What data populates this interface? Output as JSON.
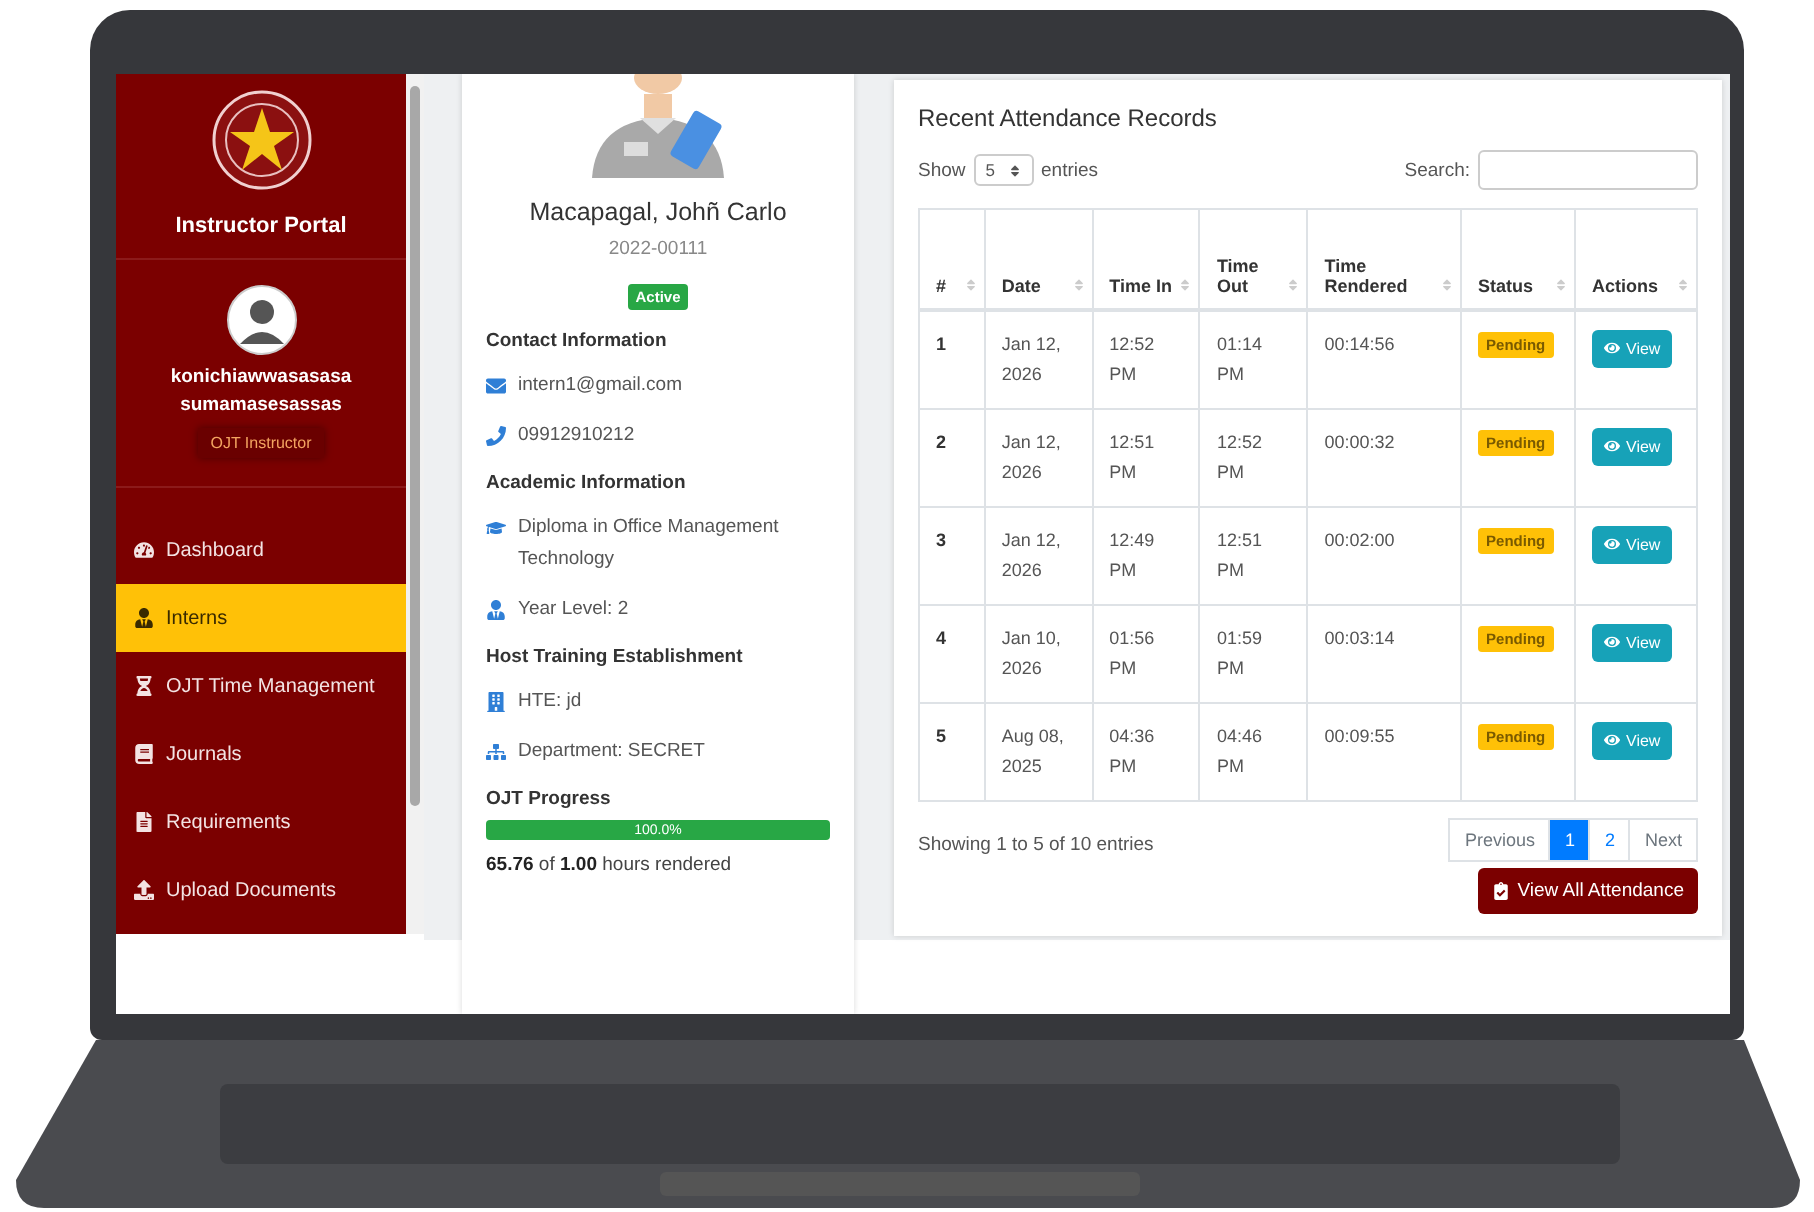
{
  "sidebar": {
    "title": "Instructor Portal",
    "user_name": "konichiawwasasasa sumamasesassas",
    "role": "OJT Instructor",
    "nav": [
      {
        "label": "Dashboard",
        "selected": false
      },
      {
        "label": "Interns",
        "selected": true
      },
      {
        "label": "OJT Time Management",
        "selected": false
      },
      {
        "label": "Journals",
        "selected": false
      },
      {
        "label": "Requirements",
        "selected": false
      },
      {
        "label": "Upload Documents",
        "selected": false
      }
    ]
  },
  "profile": {
    "name": "Macapagal, Johñ Carlo",
    "student_id": "2022-00111",
    "status": "Active",
    "sections": [
      {
        "heading": "Contact Information",
        "items": [
          "intern1@gmail.com",
          "09912910212"
        ]
      },
      {
        "heading": "Academic Information",
        "items": [
          "Diploma in Office Management Technology",
          "Year Level: 2"
        ]
      },
      {
        "heading": "Host Training Establishment",
        "items": [
          "HTE: jd",
          "Department: SECRET"
        ]
      }
    ],
    "progress": {
      "heading": "OJT Progress",
      "level": 1.0,
      "reading": "100.0%",
      "summary": "**65.76** of **1.00** hours rendered"
    }
  },
  "attendance": {
    "title": "Recent Attendance Records",
    "show_label": "Show",
    "page_size": "5",
    "entries_label": "entries",
    "search_label": "Search:",
    "columns": [
      "#",
      "Date",
      "Time In",
      "Time Out",
      "Time Rendered",
      "Status",
      "Actions"
    ],
    "rows": [
      {
        "no": "1",
        "date": "Jan 12, 2026",
        "time_in": "12:52 PM",
        "time_out": "01:14 PM",
        "rendered": "00:14:56",
        "status": "Pending",
        "action": "View"
      },
      {
        "no": "2",
        "date": "Jan 12, 2026",
        "time_in": "12:51 PM",
        "time_out": "12:52 PM",
        "rendered": "00:00:32",
        "status": "Pending",
        "action": "View"
      },
      {
        "no": "3",
        "date": "Jan 12, 2026",
        "time_in": "12:49 PM",
        "time_out": "12:51 PM",
        "rendered": "00:02:00",
        "status": "Pending",
        "action": "View"
      },
      {
        "no": "4",
        "date": "Jan 10, 2026",
        "time_in": "01:56 PM",
        "time_out": "01:59 PM",
        "rendered": "00:03:14",
        "status": "Pending",
        "action": "View"
      },
      {
        "no": "5",
        "date": "Aug 08, 2025",
        "time_in": "04:36 PM",
        "time_out": "04:46 PM",
        "rendered": "00:09:55",
        "status": "Pending",
        "action": "View"
      }
    ],
    "info": "Showing 1 to 5 of 10 entries",
    "pagination": [
      {
        "label": "Previous",
        "kind": "nav",
        "selected": false
      },
      {
        "label": "1",
        "kind": "page",
        "selected": true
      },
      {
        "label": "2",
        "kind": "page",
        "selected": false
      },
      {
        "label": "Next",
        "kind": "nav",
        "selected": false
      }
    ],
    "view_all": "View All Attendance"
  }
}
